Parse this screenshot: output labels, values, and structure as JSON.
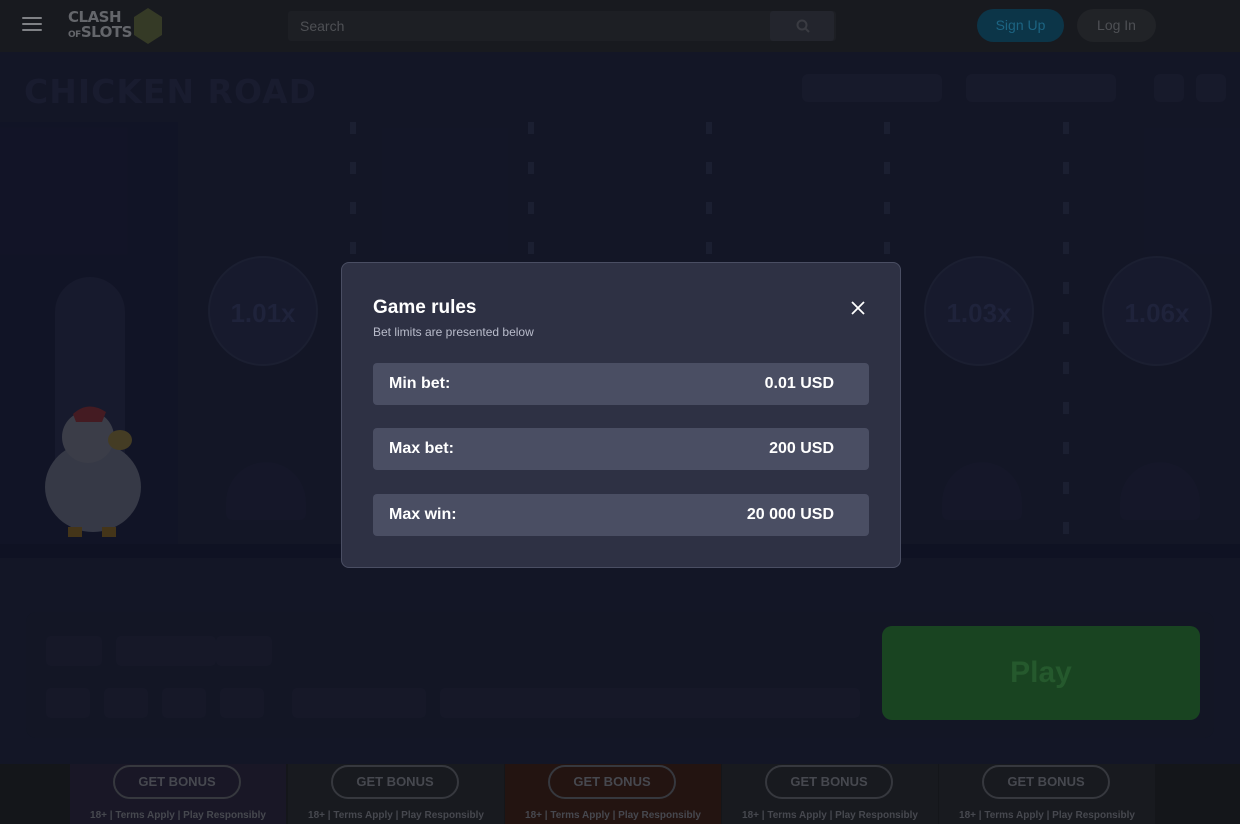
{
  "header": {
    "logo_line1": "CLASH",
    "logo_line2_small": "OF",
    "logo_line2": "SLOTS",
    "search_placeholder": "Search",
    "signup_label": "Sign Up",
    "login_label": "Log In"
  },
  "game": {
    "title": "CHICKEN ROAD",
    "multipliers": [
      "1.01x",
      "1.03x",
      "1.06x"
    ]
  },
  "control": {
    "play_label": "Play"
  },
  "bonus_strip": {
    "items": [
      {
        "button": "GET BONUS",
        "note": "18+ | Terms Apply | Play Responsibly",
        "bg": "#1c1a2a"
      },
      {
        "button": "GET BONUS",
        "note": "18+ | Terms Apply | Play Responsibly",
        "bg": "#1b1d22"
      },
      {
        "button": "GET BONUS",
        "note": "18+ | Terms Apply | Play Responsibly",
        "bg": "#271613"
      },
      {
        "button": "GET BONUS",
        "note": "18+ | Terms Apply | Play Responsibly",
        "bg": "#1b1d22"
      },
      {
        "button": "GET BONUS",
        "note": "18+ | Terms Apply | Play Responsibly",
        "bg": "#1b1d22"
      }
    ]
  },
  "modal": {
    "title": "Game rules",
    "subtitle": "Bet limits are presented below",
    "rows": [
      {
        "label": "Min bet:",
        "value": "0.01 USD"
      },
      {
        "label": "Max bet:",
        "value": "200 USD"
      },
      {
        "label": "Max win:",
        "value": "20 000 USD"
      }
    ]
  },
  "colors": {
    "modal_bg": "#2e3144",
    "row_bg": "#4a4e63",
    "play_green": "#1c4a24",
    "signup_blue": "#0e3a4f"
  }
}
